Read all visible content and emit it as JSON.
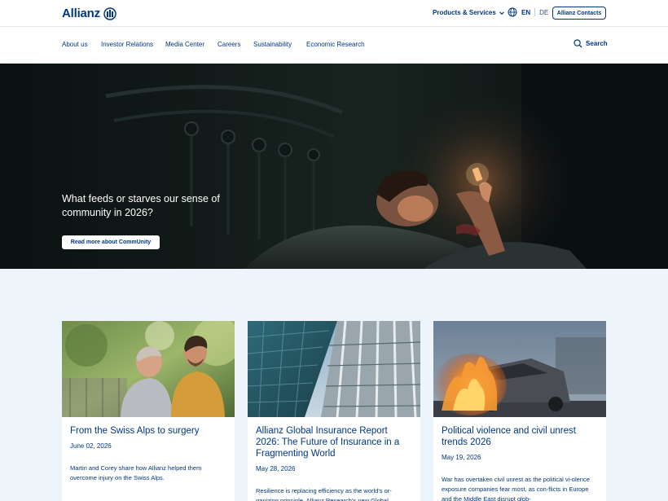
{
  "header": {
    "logo_text": "Allianz",
    "products_label": "Products & Services",
    "lang_en": "EN",
    "lang_de": "DE",
    "contacts_label": "Allianz Contacts"
  },
  "nav": {
    "items": [
      "About us",
      "Investor Relations",
      "Media Center",
      "Careers",
      "Sustainability",
      "Economic Research"
    ],
    "search_label": "Search"
  },
  "hero": {
    "title": "What feeds or starves our sense of community in 2026?",
    "button_label": "Read more about CommUnity"
  },
  "cards": [
    {
      "title": "From the Swiss Alps to surgery",
      "date": "June 02, 2026",
      "desc": "Martin and Corey share how Allianz helped them overcome injury on the Swiss Alps."
    },
    {
      "title": "Allianz Global Insurance Report 2026: The Future of Insurance in a Fragmenting World",
      "date": "May 28, 2026",
      "desc": "Resilience is replacing efficiency as the world's or-ganizing principle. Allianz Research's new Global"
    },
    {
      "title": "Political violence and civil unrest trends 2026",
      "date": "May 19, 2026",
      "desc": "War has overtaken civil unrest as the political vi-olence exposure companies fear most, as con-flicts in Europe and the Middle East disrupt glob-"
    }
  ],
  "colors": {
    "brand": "#003781",
    "news_bg": "#eef5fa"
  },
  "icons": [
    "allianz-logo-icon",
    "chevron-down-icon",
    "globe-icon",
    "search-icon"
  ]
}
